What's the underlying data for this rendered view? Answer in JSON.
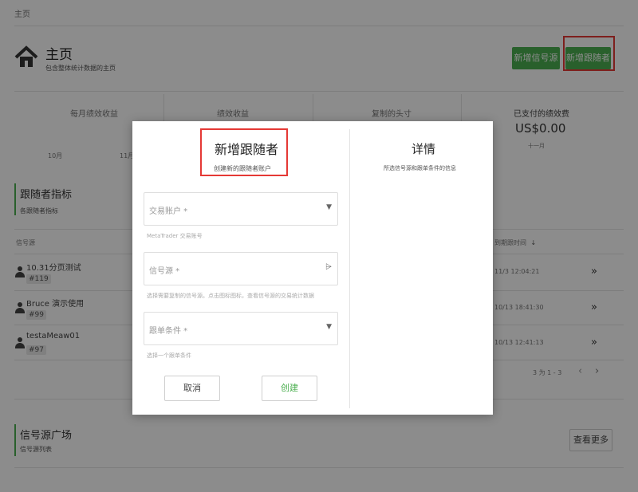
{
  "breadcrumb": "主页",
  "header": {
    "title": "主页",
    "subtitle": "包含整体统计数据的主页",
    "btn_new_signal": "新增信号源",
    "btn_new_follower": "新增跟随者"
  },
  "stats": {
    "col1": "每月绩效收益",
    "col2": "绩效收益",
    "col3": "复制的头寸",
    "col4": "已支付的绩效费",
    "col4_value": "US$0.00",
    "col4_sub": "十一月",
    "month1": "10月",
    "month2": "11月"
  },
  "followers": {
    "title": "跟随者指标",
    "subtitle": "各跟随者指标",
    "col_signal": "信号源",
    "col_time": "到期跟时间",
    "sort_icon": "arrow-down-icon",
    "rows": [
      {
        "name": "10.31分页测试",
        "tag": "#119",
        "time": "11/3 12:04:21"
      },
      {
        "name": "Bruce 演示使用",
        "tag": "#99",
        "time": "10/13 18:41:30"
      },
      {
        "name": "testaMeaw01",
        "tag": "#97",
        "time": "10/13 12:41:13"
      }
    ],
    "pagination": "3 为 1 - 3"
  },
  "market": {
    "title": "信号源广场",
    "subtitle": "信号源列表",
    "view_more": "查看更多"
  },
  "modal": {
    "title": "新增跟随者",
    "subtitle": "创建新的跟随者账户",
    "account_label": "交易账户 *",
    "account_hint": "MetaTrader 交易账号",
    "signal_label": "信号源 *",
    "signal_hint": "选择需要复制的信号源。点击图标图标，查看信号源的交易统计数据",
    "condition_label": "跟单条件 *",
    "condition_hint": "选择一个跟单条件",
    "cancel": "取消",
    "create": "创建",
    "details_title": "详情",
    "details_text": "所选信号源和跟单条件的信息"
  },
  "colors": {
    "green": "#4caf50",
    "highlight": "#e53935",
    "overlay": "rgba(0,0,0,0.45)"
  }
}
